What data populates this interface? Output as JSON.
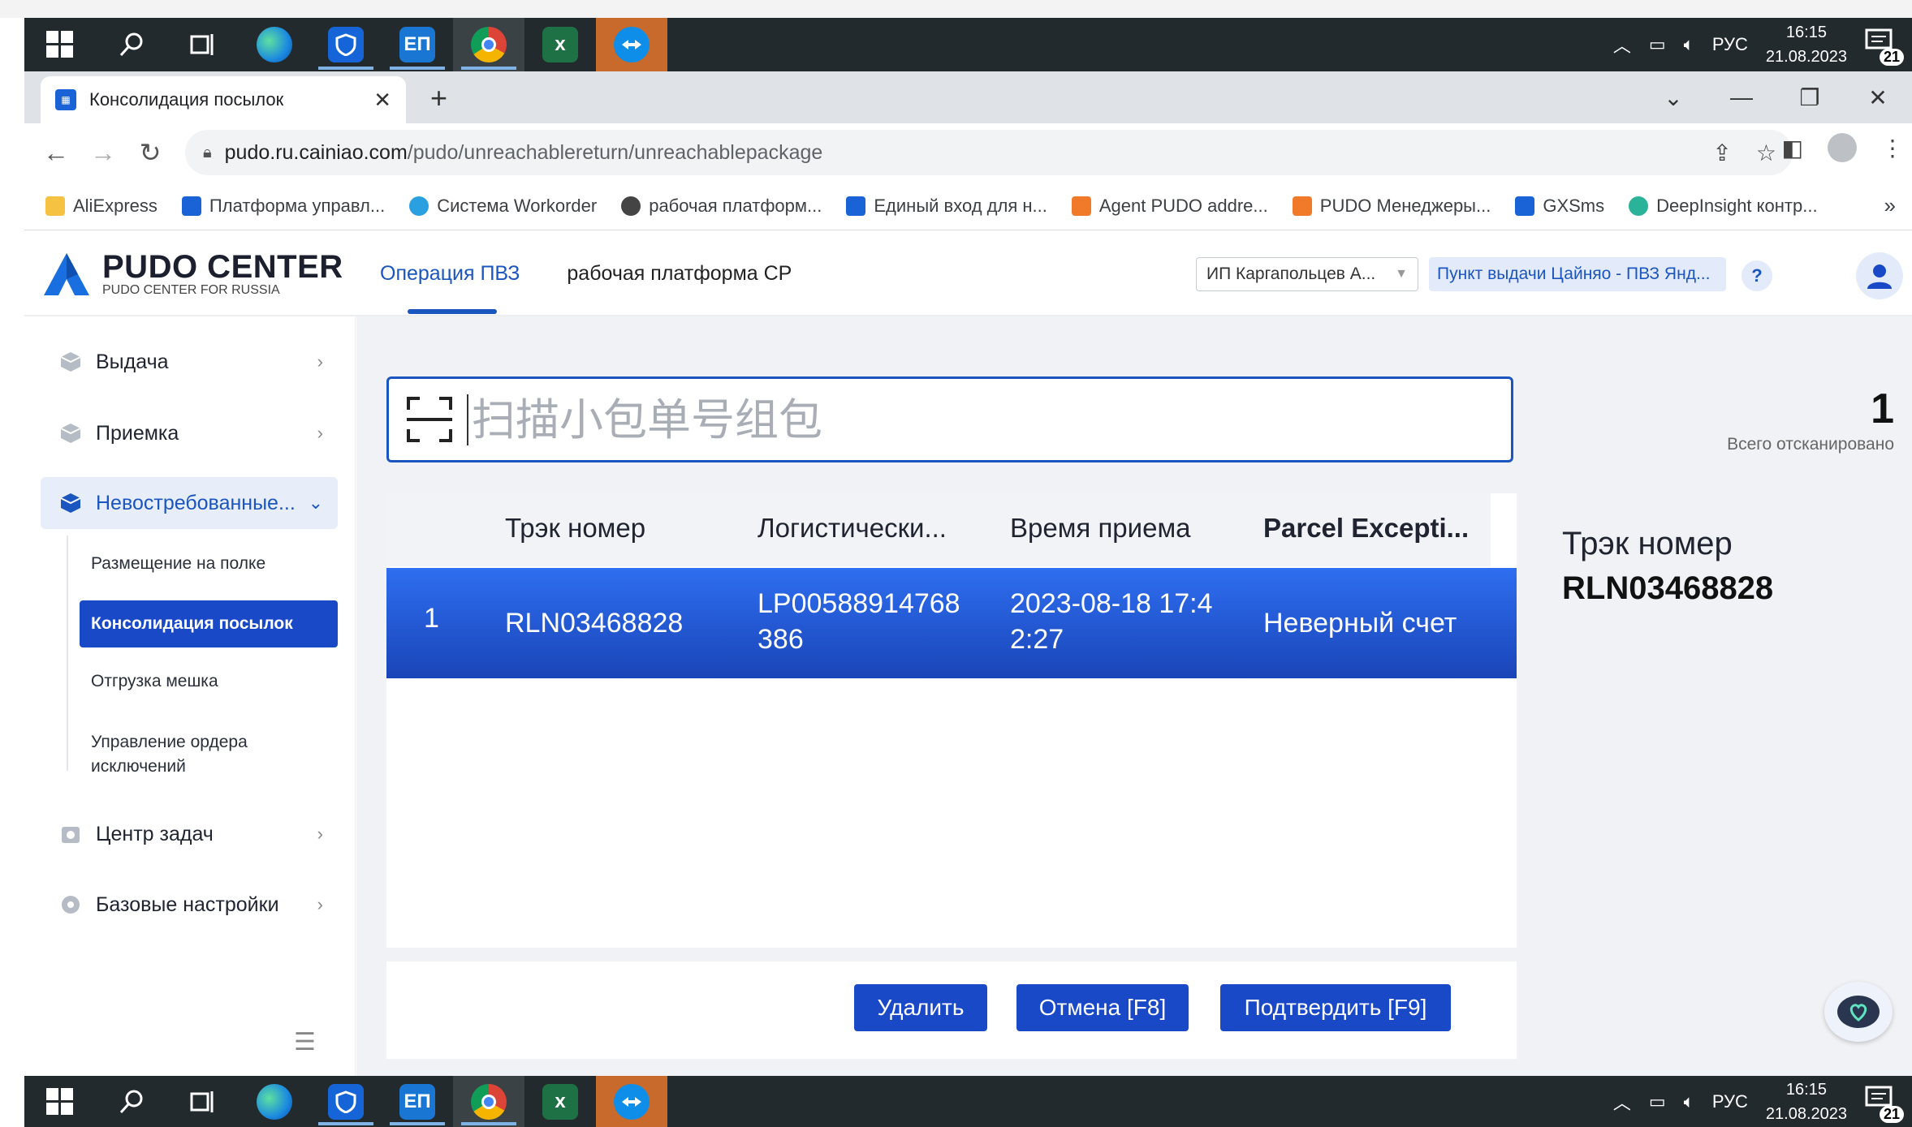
{
  "taskbar": {
    "apps": [
      "start-icon",
      "search-icon",
      "task-view-icon",
      "edge-icon",
      "defender-icon",
      "ep-app-icon",
      "chrome-icon",
      "excel-icon",
      "teamviewer-icon"
    ],
    "ep_label": "ЕП",
    "excel_label": "x",
    "tray": {
      "lang": "РУС",
      "time": "16:15",
      "date": "21.08.2023",
      "notifications": "21"
    }
  },
  "browser": {
    "tab_title": "Консолидация посылок",
    "url_host": "pudo.ru.cainiao.com",
    "url_path": "/pudo/unreachablereturn/unreachablepackage",
    "bookmarks": [
      "AliExpress",
      "Платформа управл...",
      "Система Workorder",
      "рабочая платформ...",
      "Единый вход для н...",
      "Agent PUDO addre...",
      "PUDO Менеджеры...",
      "GXSms",
      "DeepInsight контр..."
    ],
    "more": "»"
  },
  "header": {
    "logo_title": "PUDO CENTER",
    "logo_sub": "PUDO CENTER FOR RUSSIA",
    "nav": [
      "Операция ПВЗ",
      "рабочая платформа CP"
    ],
    "merchant": "ИП Каргапольцев А...",
    "point": "Пункт выдачи Цайняо - ПВЗ Янд...",
    "help": "?"
  },
  "sidebar": {
    "items": [
      {
        "label": "Выдача",
        "icon": "box-icon"
      },
      {
        "label": "Приемка",
        "icon": "box-icon"
      },
      {
        "label": "Невостребованные...",
        "icon": "box-icon"
      },
      {
        "label": "Центр задач",
        "icon": "task-icon"
      },
      {
        "label": "Базовые настройки",
        "icon": "gear-icon"
      }
    ],
    "sub_items": [
      "Размещение на полке",
      "Консолидация посылок",
      "Отгрузка мешка",
      "Управление ордера исключений"
    ]
  },
  "scan": {
    "placeholder": "扫描小包单号组包",
    "count": "1",
    "count_label": "Всего отсканировано"
  },
  "table": {
    "columns": [
      "Трэк номер",
      "Логистически...",
      "Время приема",
      "Parcel Excepti..."
    ],
    "rows": [
      {
        "index": "1",
        "track": "RLN03468828",
        "logistic_line1": "LP00588914768",
        "logistic_line2": "386",
        "time_line1": "2023-08-18 17:4",
        "time_line2": "2:27",
        "exception": "Неверный счет"
      }
    ]
  },
  "detail": {
    "label": "Трэк номер",
    "value": "RLN03468828"
  },
  "actions": {
    "delete": "Удалить",
    "cancel": "Отмена [F8]",
    "confirm": "Подтвердить [F9]"
  },
  "colors": {
    "primary": "#1a49c8",
    "row_gradient_top": "#2e6ef0",
    "row_gradient_bottom": "#1a45b8"
  }
}
